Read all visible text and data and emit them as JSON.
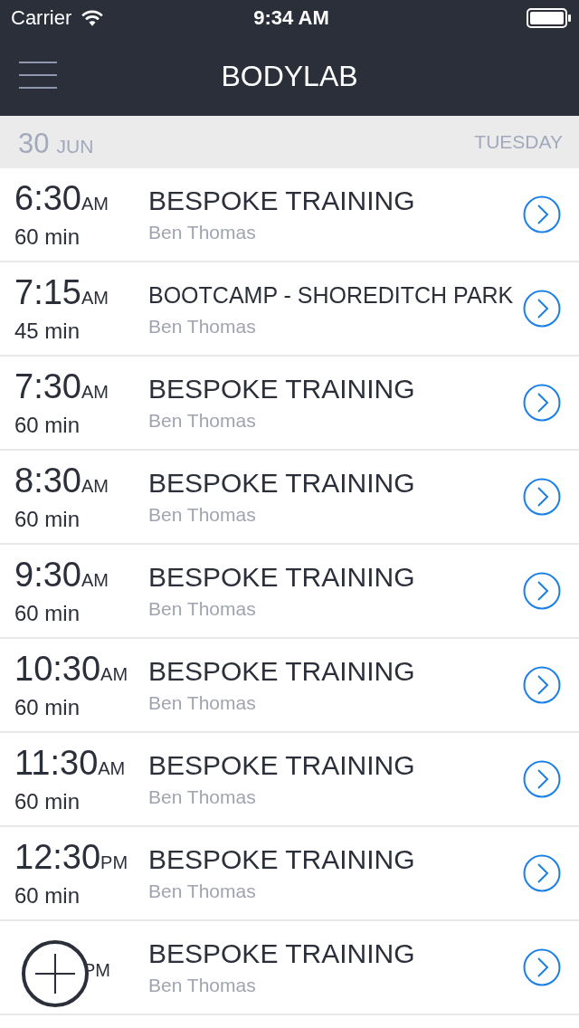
{
  "status_bar": {
    "carrier": "Carrier",
    "time": "9:34 AM"
  },
  "nav_bar": {
    "title": "BODYLAB"
  },
  "date_header": {
    "day": "30",
    "month": "JUN",
    "weekday": "TUESDAY"
  },
  "sessions": [
    {
      "time": "6:30",
      "period": "AM",
      "duration": "60 min",
      "title": "BESPOKE TRAINING",
      "trainer": "Ben Thomas"
    },
    {
      "time": "7:15",
      "period": "AM",
      "duration": "45 min",
      "title": "BOOTCAMP - SHOREDITCH PARK",
      "trainer": "Ben Thomas"
    },
    {
      "time": "7:30",
      "period": "AM",
      "duration": "60 min",
      "title": "BESPOKE TRAINING",
      "trainer": "Ben Thomas"
    },
    {
      "time": "8:30",
      "period": "AM",
      "duration": "60 min",
      "title": "BESPOKE TRAINING",
      "trainer": "Ben Thomas"
    },
    {
      "time": "9:30",
      "period": "AM",
      "duration": "60 min",
      "title": "BESPOKE TRAINING",
      "trainer": "Ben Thomas"
    },
    {
      "time": "10:30",
      "period": "AM",
      "duration": "60 min",
      "title": "BESPOKE TRAINING",
      "trainer": "Ben Thomas"
    },
    {
      "time": "11:30",
      "period": "AM",
      "duration": "60 min",
      "title": "BESPOKE TRAINING",
      "trainer": "Ben Thomas"
    },
    {
      "time": "12:30",
      "period": "PM",
      "duration": "60 min",
      "title": "BESPOKE TRAINING",
      "trainer": "Ben Thomas"
    },
    {
      "period": "PM",
      "title": "BESPOKE TRAINING",
      "trainer": "Ben Thomas"
    }
  ]
}
